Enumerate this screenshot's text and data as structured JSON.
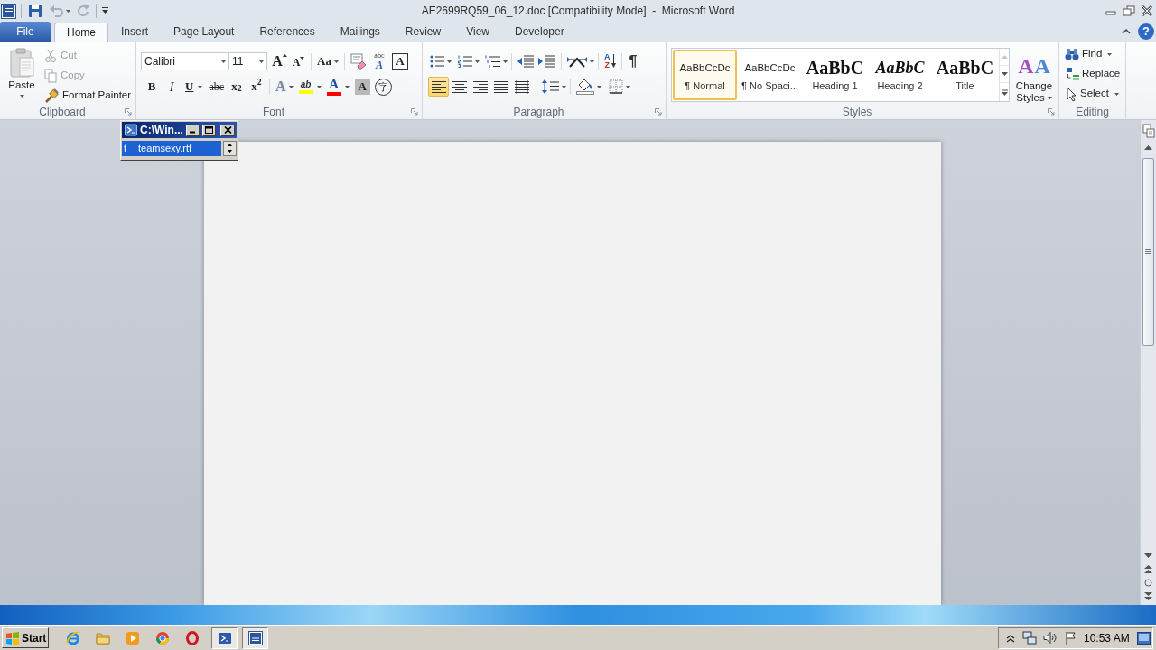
{
  "window": {
    "title": "AE2699RQ59_06_12.doc [Compatibility Mode]  -  Microsoft Word",
    "quick_access": [
      {
        "kind": "save",
        "disabled": false
      },
      {
        "kind": "undo",
        "disabled": true
      },
      {
        "kind": "redo",
        "disabled": true
      }
    ],
    "help": "?"
  },
  "tabs": [
    {
      "label": "File",
      "kind": "backstage",
      "selected": false
    },
    {
      "label": "Home",
      "kind": "tab",
      "selected": true
    },
    {
      "label": "Insert",
      "kind": "tab",
      "selected": false
    },
    {
      "label": "Page Layout",
      "kind": "tab",
      "selected": false
    },
    {
      "label": "References",
      "kind": "tab",
      "selected": false
    },
    {
      "label": "Mailings",
      "kind": "tab",
      "selected": false
    },
    {
      "label": "Review",
      "kind": "tab",
      "selected": false
    },
    {
      "label": "View",
      "kind": "tab",
      "selected": false
    },
    {
      "label": "Developer",
      "kind": "tab",
      "selected": false
    }
  ],
  "ribbon": {
    "clipboard": {
      "label": "Clipboard",
      "paste": "Paste",
      "commands": [
        {
          "kind": "cut",
          "label": "Cut",
          "disabled": true
        },
        {
          "kind": "copy",
          "label": "Copy",
          "disabled": true
        },
        {
          "kind": "format_painter",
          "label": "Format Painter",
          "disabled": false
        }
      ]
    },
    "font": {
      "label": "Font",
      "font_name": "Calibri",
      "font_size": "11",
      "row_1": [
        {
          "kind": "grow_font",
          "glyph": "A"
        },
        {
          "kind": "shrink_font",
          "glyph": "A"
        },
        {
          "kind": "change_case",
          "glyph": "Aa"
        },
        {
          "kind": "clear_formatting"
        },
        {
          "kind": "phonetic_guide",
          "glyph": "abc",
          "sub_glyph": "A"
        },
        {
          "kind": "character_border",
          "glyph": "A"
        }
      ],
      "row_2": [
        {
          "kind": "bold",
          "glyph": "B"
        },
        {
          "kind": "italic",
          "glyph": "I"
        },
        {
          "kind": "underline",
          "glyph": "U"
        },
        {
          "kind": "strikethrough",
          "glyph": "abc"
        },
        {
          "kind": "subscript",
          "glyph": "x$_{2}$"
        },
        {
          "kind": "superscript",
          "glyph": "x$^{2}$"
        },
        {
          "kind": "text_effects",
          "glyph": "A"
        },
        {
          "kind": "highlight",
          "glyph": "ab",
          "color": "#ffff00"
        },
        {
          "kind": "font_color",
          "glyph": "A",
          "color": "#ff0000"
        },
        {
          "kind": "character_shading",
          "glyph": "A"
        },
        {
          "kind": "enclose_characters",
          "glyph": "字"
        }
      ]
    },
    "paragraph": {
      "label": "Paragraph",
      "row_1": [
        {
          "kind": "bullets"
        },
        {
          "kind": "numbering"
        },
        {
          "kind": "multilevel_list"
        },
        {
          "kind": "decrease_indent"
        },
        {
          "kind": "increase_indent"
        },
        {
          "kind": "asian_layout"
        },
        {
          "kind": "sort",
          "glyph": "A",
          "sub_glyph": "Z"
        },
        {
          "kind": "show_hide",
          "glyph": "¶"
        }
      ],
      "alignment": [
        {
          "kind": "left",
          "selected": true
        },
        {
          "kind": "center",
          "selected": false
        },
        {
          "kind": "right",
          "selected": false
        },
        {
          "kind": "justify",
          "selected": false
        },
        {
          "kind": "distributed",
          "selected": false
        }
      ],
      "row_2": [
        {
          "kind": "line_spacing"
        },
        {
          "kind": "shading"
        },
        {
          "kind": "borders"
        }
      ]
    },
    "styles": {
      "label": "Styles",
      "gallery": [
        {
          "kind": "normal",
          "preview": "AaBbCcDc",
          "name": "¶ Normal",
          "selected": true
        },
        {
          "kind": "normal",
          "preview": "AaBbCcDc",
          "name": "¶ No Spaci...",
          "selected": false
        },
        {
          "kind": "heading_1",
          "preview": "AaBbC",
          "name": "Heading 1",
          "selected": false
        },
        {
          "kind": "heading_2",
          "preview": "AaBbC",
          "name": "Heading 2",
          "selected": false
        },
        {
          "kind": "title",
          "preview": "AaBbC",
          "name": "Title",
          "selected": false
        }
      ],
      "change_styles": {
        "label": "Change Styles",
        "glyph": "A",
        "sub_glyph": "A"
      }
    },
    "editing": {
      "label": "Editing",
      "commands": [
        {
          "kind": "find",
          "label": "Find"
        },
        {
          "kind": "replace",
          "label": "Replace"
        },
        {
          "kind": "select",
          "label": "Select"
        }
      ]
    }
  },
  "console_window": {
    "title": "C:\\Win...",
    "row": {
      "cells": [
        "t",
        "teamsexy.rtf"
      ],
      "selected": true
    }
  },
  "taskbar": {
    "start": "Start",
    "apps": [
      {
        "kind": "internet_explorer",
        "active": false
      },
      {
        "kind": "folder",
        "active": false
      },
      {
        "kind": "media_player",
        "active": false
      },
      {
        "kind": "chrome",
        "active": false
      },
      {
        "kind": "opera",
        "active": false
      },
      {
        "kind": "powershell",
        "active": true
      },
      {
        "kind": "word",
        "active": true
      }
    ],
    "tray": [
      {
        "kind": "show_hidden"
      },
      {
        "kind": "network"
      },
      {
        "kind": "volume"
      },
      {
        "kind": "action_center"
      }
    ],
    "clock": "10:53 AM"
  }
}
